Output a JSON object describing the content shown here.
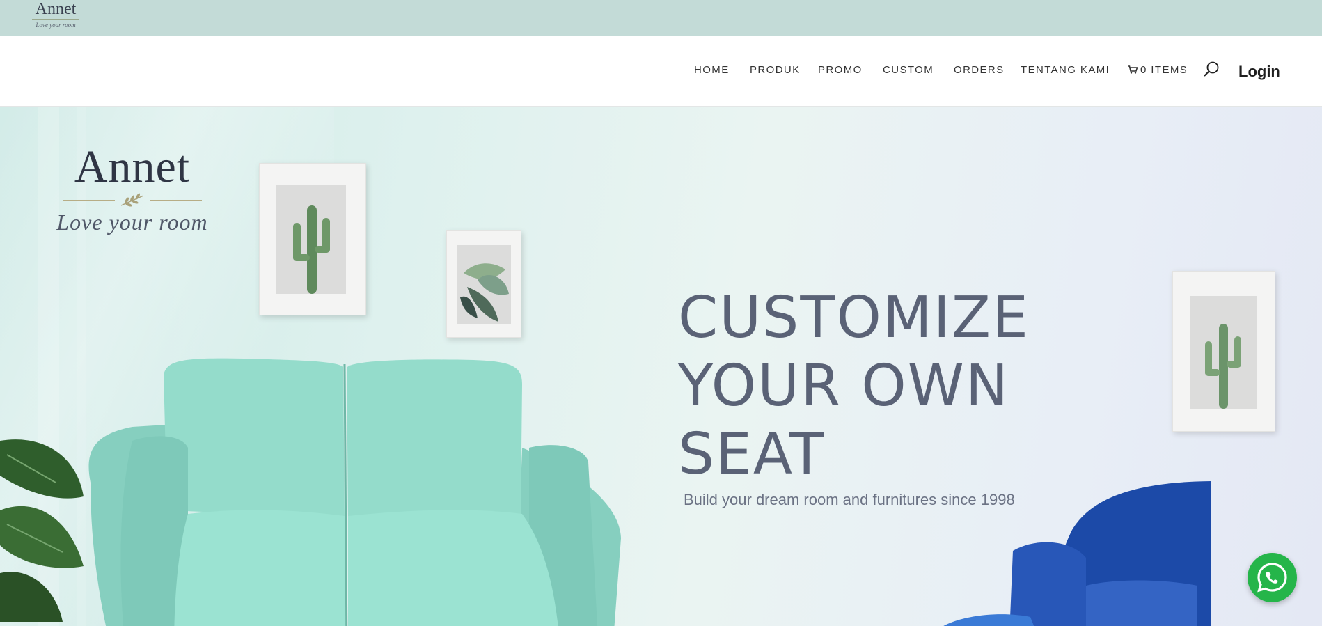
{
  "topbar": {
    "logo_name": "Annet",
    "logo_tagline": "Love your room"
  },
  "nav": {
    "items": [
      {
        "label": "HOME"
      },
      {
        "label": "PRODUK"
      },
      {
        "label": "PROMO"
      },
      {
        "label": "CUSTOM"
      },
      {
        "label": "ORDERS"
      },
      {
        "label": "TENTANG KAMI"
      }
    ],
    "cart_label": "0 ITEMS",
    "cart_icon": "cart-icon",
    "search_icon": "search-icon",
    "login_label": "Login"
  },
  "hero": {
    "logo_name": "Annet",
    "logo_tagline": "Love your room",
    "headline_line1": "CUSTOMIZE",
    "headline_line2": "YOUR OWN",
    "headline_line3": "SEAT",
    "subtitle": "Build your dream room and furnitures since 1998"
  },
  "whatsapp": {
    "icon": "whatsapp-icon",
    "color": "#25b54a"
  },
  "colors": {
    "topbar": "#c3dbd7",
    "headline": "#5a6276",
    "sofa": "#8fd6c6",
    "armchair": "#1f4fb0"
  }
}
